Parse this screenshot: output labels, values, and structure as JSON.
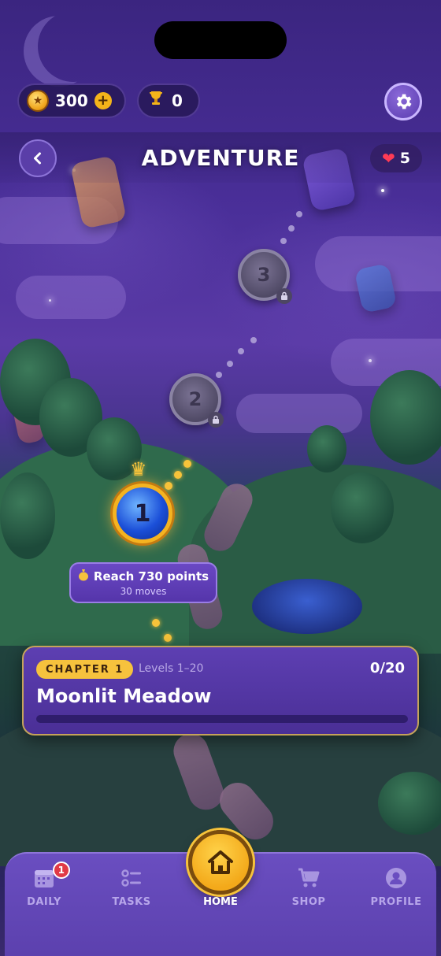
{
  "currency": {
    "coins": "300",
    "trophies": "0"
  },
  "header": {
    "title": "ADVENTURE",
    "lives": "5"
  },
  "map": {
    "levels": [
      {
        "number": "1",
        "state": "current"
      },
      {
        "number": "2",
        "state": "locked"
      },
      {
        "number": "3",
        "state": "locked"
      }
    ],
    "current_goal": {
      "title": "Reach 730 points",
      "subtitle": "30 moves"
    }
  },
  "chapter": {
    "badge": "CHAPTER 1",
    "levels_range": "Levels 1–20",
    "progress_text": "0/20",
    "progress_fraction": 0,
    "name": "Moonlit Meadow"
  },
  "nav": {
    "daily": {
      "label": "DAILY",
      "badge": "1"
    },
    "tasks": {
      "label": "TASKS"
    },
    "home": {
      "label": "HOME"
    },
    "shop": {
      "label": "SHOP"
    },
    "profile": {
      "label": "PROFILE"
    }
  },
  "colors": {
    "accent_gold": "#f6c23d",
    "panel_purple": "#5d3fb2",
    "heart_red": "#ff3b55",
    "badge_red": "#e03a46"
  },
  "icons": [
    "coin-icon",
    "plus-icon",
    "trophy-icon",
    "gear-icon",
    "back-chevron-icon",
    "heart-icon",
    "crown-icon",
    "lock-icon",
    "money-bag-icon",
    "calendar-icon",
    "tasks-list-icon",
    "home-icon",
    "cart-icon",
    "user-icon"
  ]
}
